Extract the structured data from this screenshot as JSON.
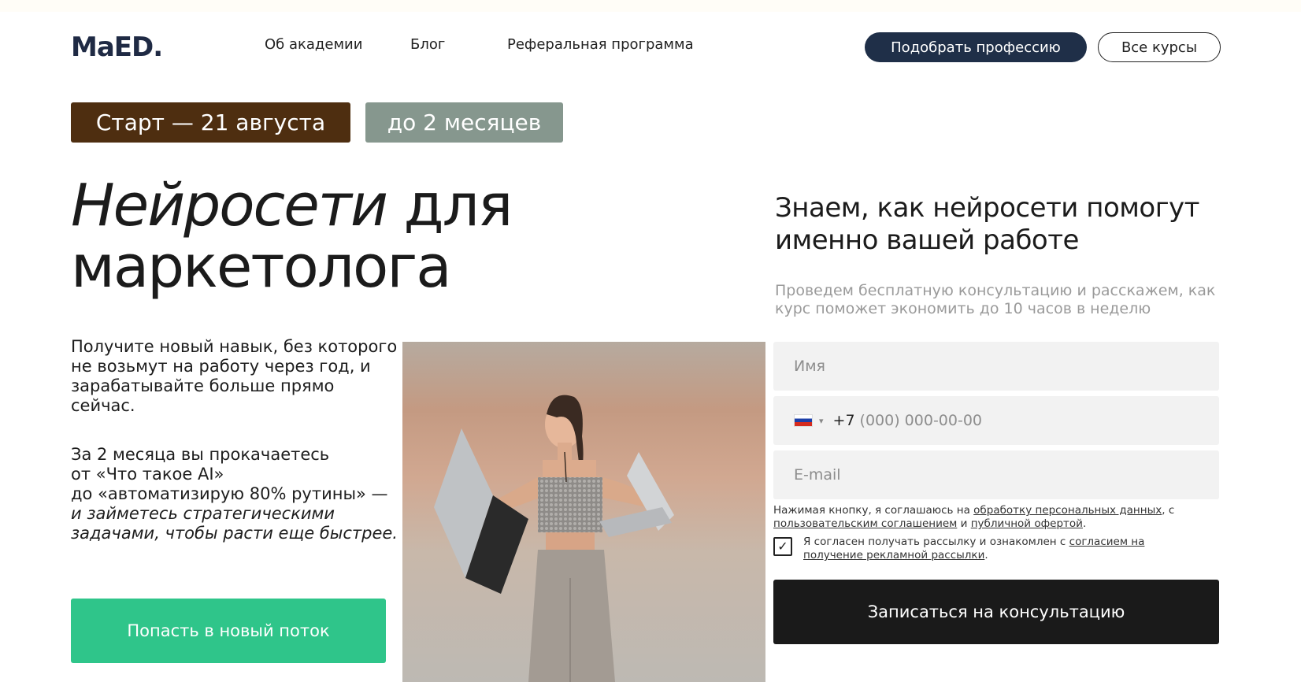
{
  "header": {
    "logo": "MaED.",
    "nav": [
      "Об академии",
      "Блог",
      "Реферальная программа"
    ],
    "cta_primary": "Подобрать профессию",
    "cta_secondary": "Все курсы"
  },
  "tags": {
    "start": "Старт —  21 августа",
    "duration": "до 2 месяцев"
  },
  "hero": {
    "title_italic": "Нейросети",
    "title_rest_line1": " для",
    "title_line2": "маркетолога",
    "lead": "Получите новый навык, без которого не возьмут на работу через год, и зарабатывайте больше прямо сейчас.",
    "lead2_lines": [
      "За 2 месяца вы прокачаетесь",
      "от «Что такое AI»",
      "до «автоматизирую 80% рутины» —"
    ],
    "lead2_italic": "и займетесь стратегическими задачами, чтобы расти еще быстрее.",
    "cta": "Попасть в новый поток"
  },
  "form": {
    "title": "Знаем, как нейросети помогут именно вашей работе",
    "subtitle": "Проведем бесплатную консультацию и расскажем, как курс поможет экономить до 10 часов в неделю",
    "name_placeholder": "Имя",
    "phone_prefix": "+7",
    "phone_placeholder": "(000) 000-00-00",
    "email_placeholder": "E-mail",
    "consent_prefix": "Нажимая кнопку, я соглашаюсь на ",
    "consent_link1": "обработку персональных данных",
    "consent_mid": ", с ",
    "consent_link2": "пользовательским соглашением",
    "consent_and": " и ",
    "consent_link3": "публичной офертой",
    "consent_end": ".",
    "newsletter_prefix": "Я согласен получать рассылку и ознакомлен с ",
    "newsletter_link": "согласием на получение рекламной рассылки",
    "newsletter_end": ".",
    "checkbox_checked": true,
    "submit": "Записаться на консультацию"
  },
  "icons": {
    "flag": "russia-flag-icon",
    "checkmark": "✓",
    "caret": "▾"
  }
}
